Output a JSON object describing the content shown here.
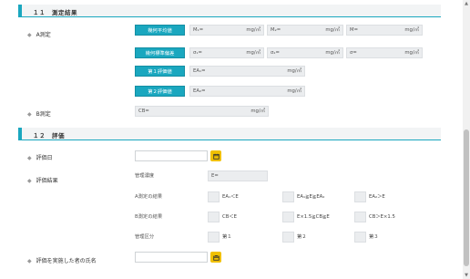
{
  "section11": {
    "title": "１１　測定結果"
  },
  "section12": {
    "title": "１２　評価"
  },
  "a_measure": {
    "label": "A測定",
    "geo_mean_btn": "幾何平均値",
    "geo_std_btn": "幾何標準偏差",
    "eval1_btn": "第１評価値",
    "eval2_btn": "第２評価値",
    "m1": "M₁=",
    "m2": "M₂=",
    "m": "M=",
    "s1": "σ₁=",
    "s2": "σ₂=",
    "s": "σ=",
    "ea1": "EA₁=",
    "ea2": "EA₂=",
    "unit": "mg/㎥"
  },
  "b_measure": {
    "label": "B測定",
    "cb": "CB=",
    "unit": "mg/㎥"
  },
  "eval_date": {
    "label": "評価日"
  },
  "eval_result": {
    "label": "評価結果",
    "mgmt_conc": "管理濃度",
    "e_field": "E=",
    "a_result": "A測定の結果",
    "a_opts": [
      "EA₁＜E",
      "EA₁≧E≧EA₂",
      "EA₂＞E"
    ],
    "b_result": "B測定の結果",
    "b_opts": [
      "CB＜E",
      "E×1.5≧CB≧E",
      "CB＞E×1.5"
    ],
    "class": "管理区分",
    "class_opts": [
      "第１",
      "第２",
      "第３"
    ]
  },
  "evaluator": {
    "label": "評価を実施した者の氏名"
  },
  "icons": {
    "calendar": "calendar-icon",
    "dot": "bullet-dot-icon"
  }
}
